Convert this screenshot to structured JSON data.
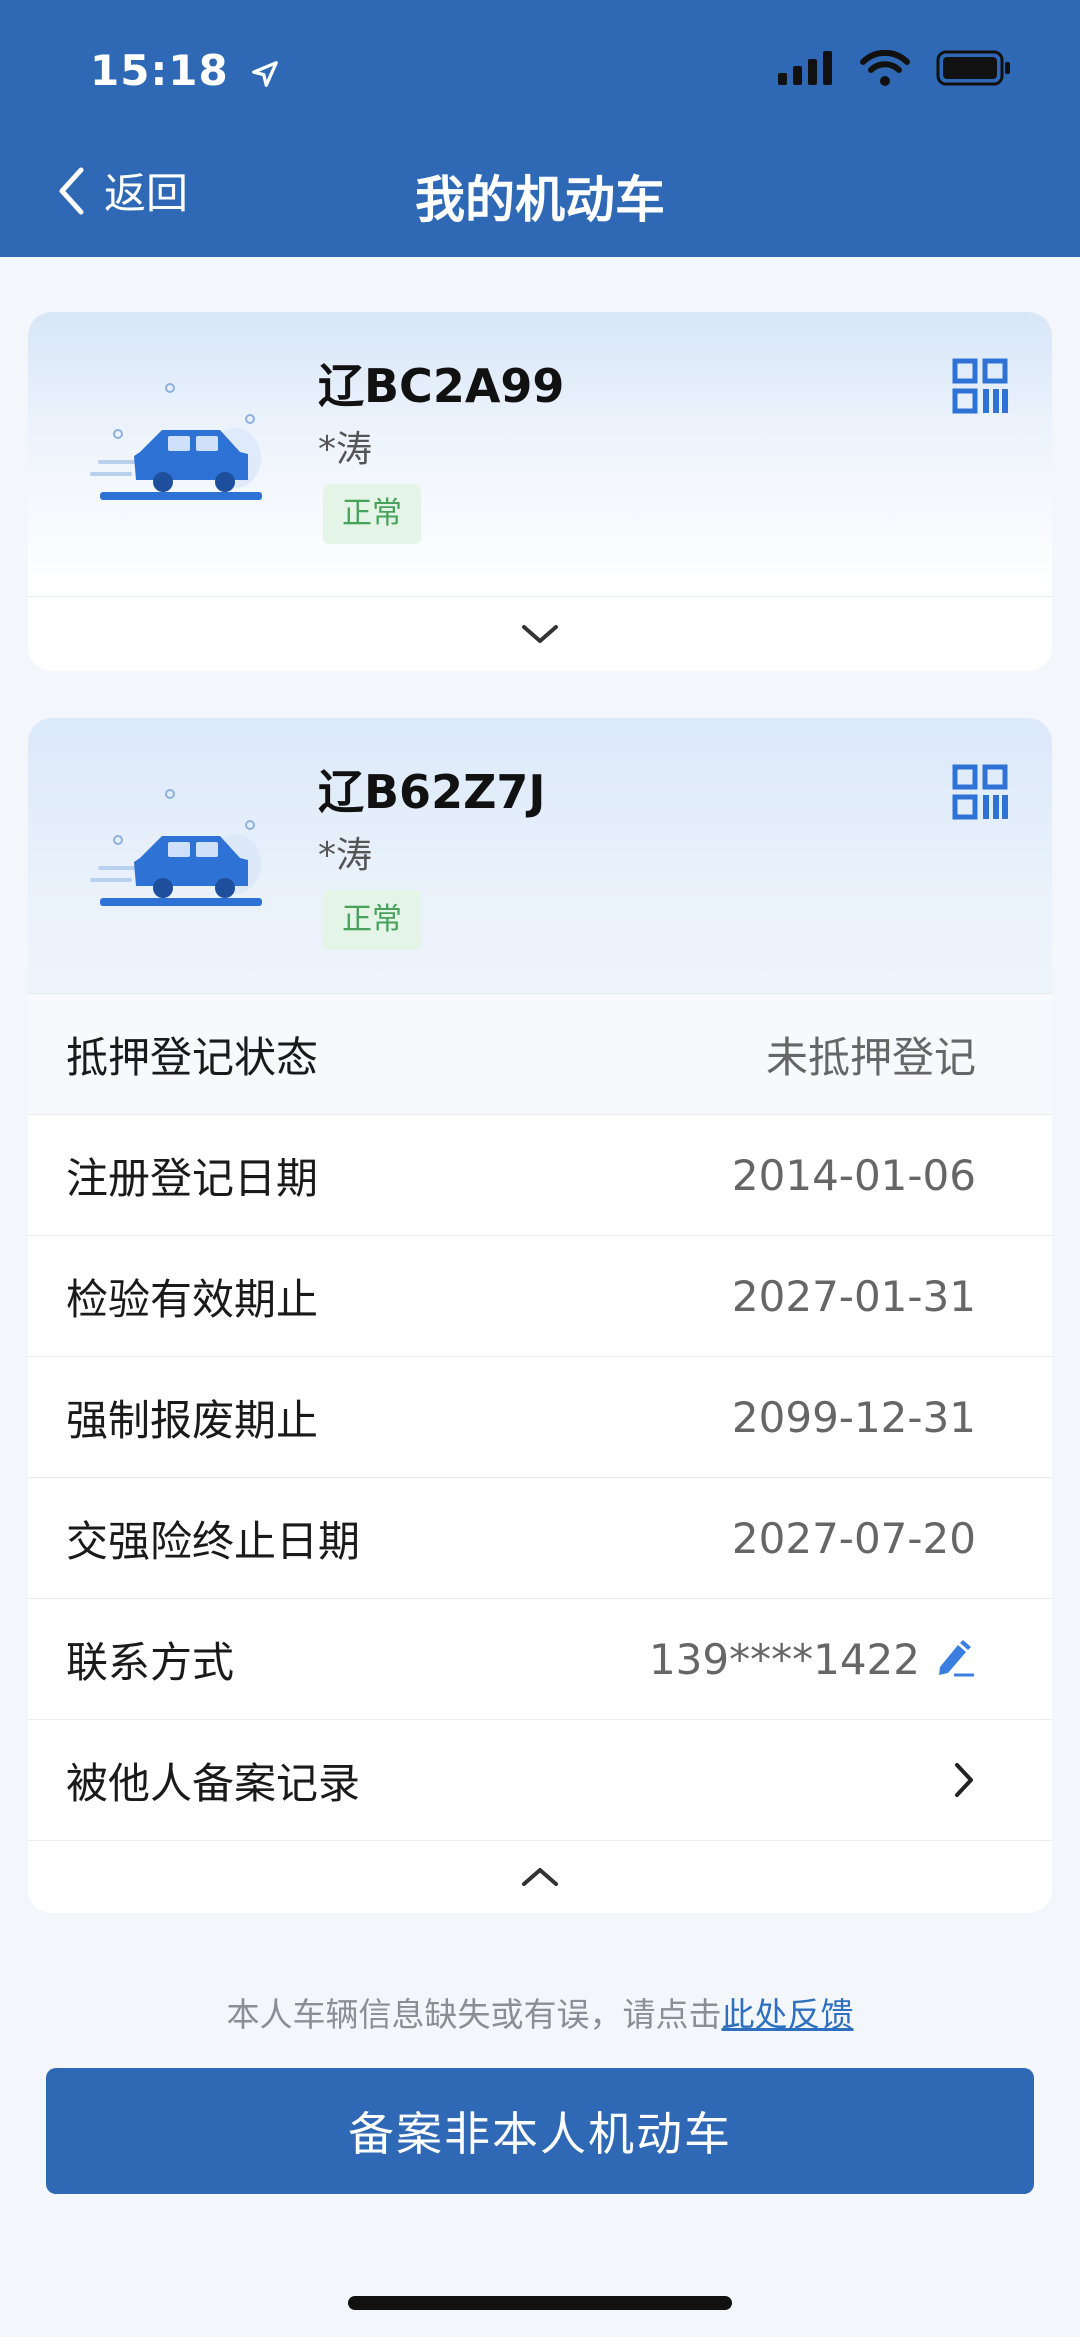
{
  "status_bar": {
    "time": "15:18"
  },
  "header": {
    "back_label": "返回",
    "title": "我的机动车"
  },
  "vehicles": [
    {
      "plate": "辽BC2A99",
      "owner": "*涛",
      "status": "正常",
      "expanded": false
    },
    {
      "plate": "辽B62Z7J",
      "owner": "*涛",
      "status": "正常",
      "expanded": true,
      "details": [
        {
          "label": "抵押登记状态",
          "value": "未抵押登记"
        },
        {
          "label": "注册登记日期",
          "value": "2014-01-06"
        },
        {
          "label": "检验有效期止",
          "value": "2027-01-31"
        },
        {
          "label": "强制报废期止",
          "value": "2099-12-31"
        },
        {
          "label": "交强险终止日期",
          "value": "2027-07-20"
        },
        {
          "label": "联系方式",
          "value": "139****1422"
        },
        {
          "label": "被他人备案记录",
          "value": ""
        }
      ]
    }
  ],
  "footer": {
    "feedback_text": "本人车辆信息缺失或有误，请点击",
    "feedback_link": "此处反馈",
    "primary_button": "备案非本人机动车"
  },
  "colors": {
    "brand_blue": "#2f69b6",
    "status_green": "#47a25c",
    "link_blue": "#2f6fbf"
  },
  "icons": [
    "location-arrow-icon",
    "signal-icon",
    "wifi-icon",
    "battery-icon",
    "chevron-left-icon",
    "car-icon",
    "qr-code-icon",
    "chevron-down-icon",
    "chevron-up-icon",
    "edit-icon",
    "chevron-right-icon"
  ]
}
